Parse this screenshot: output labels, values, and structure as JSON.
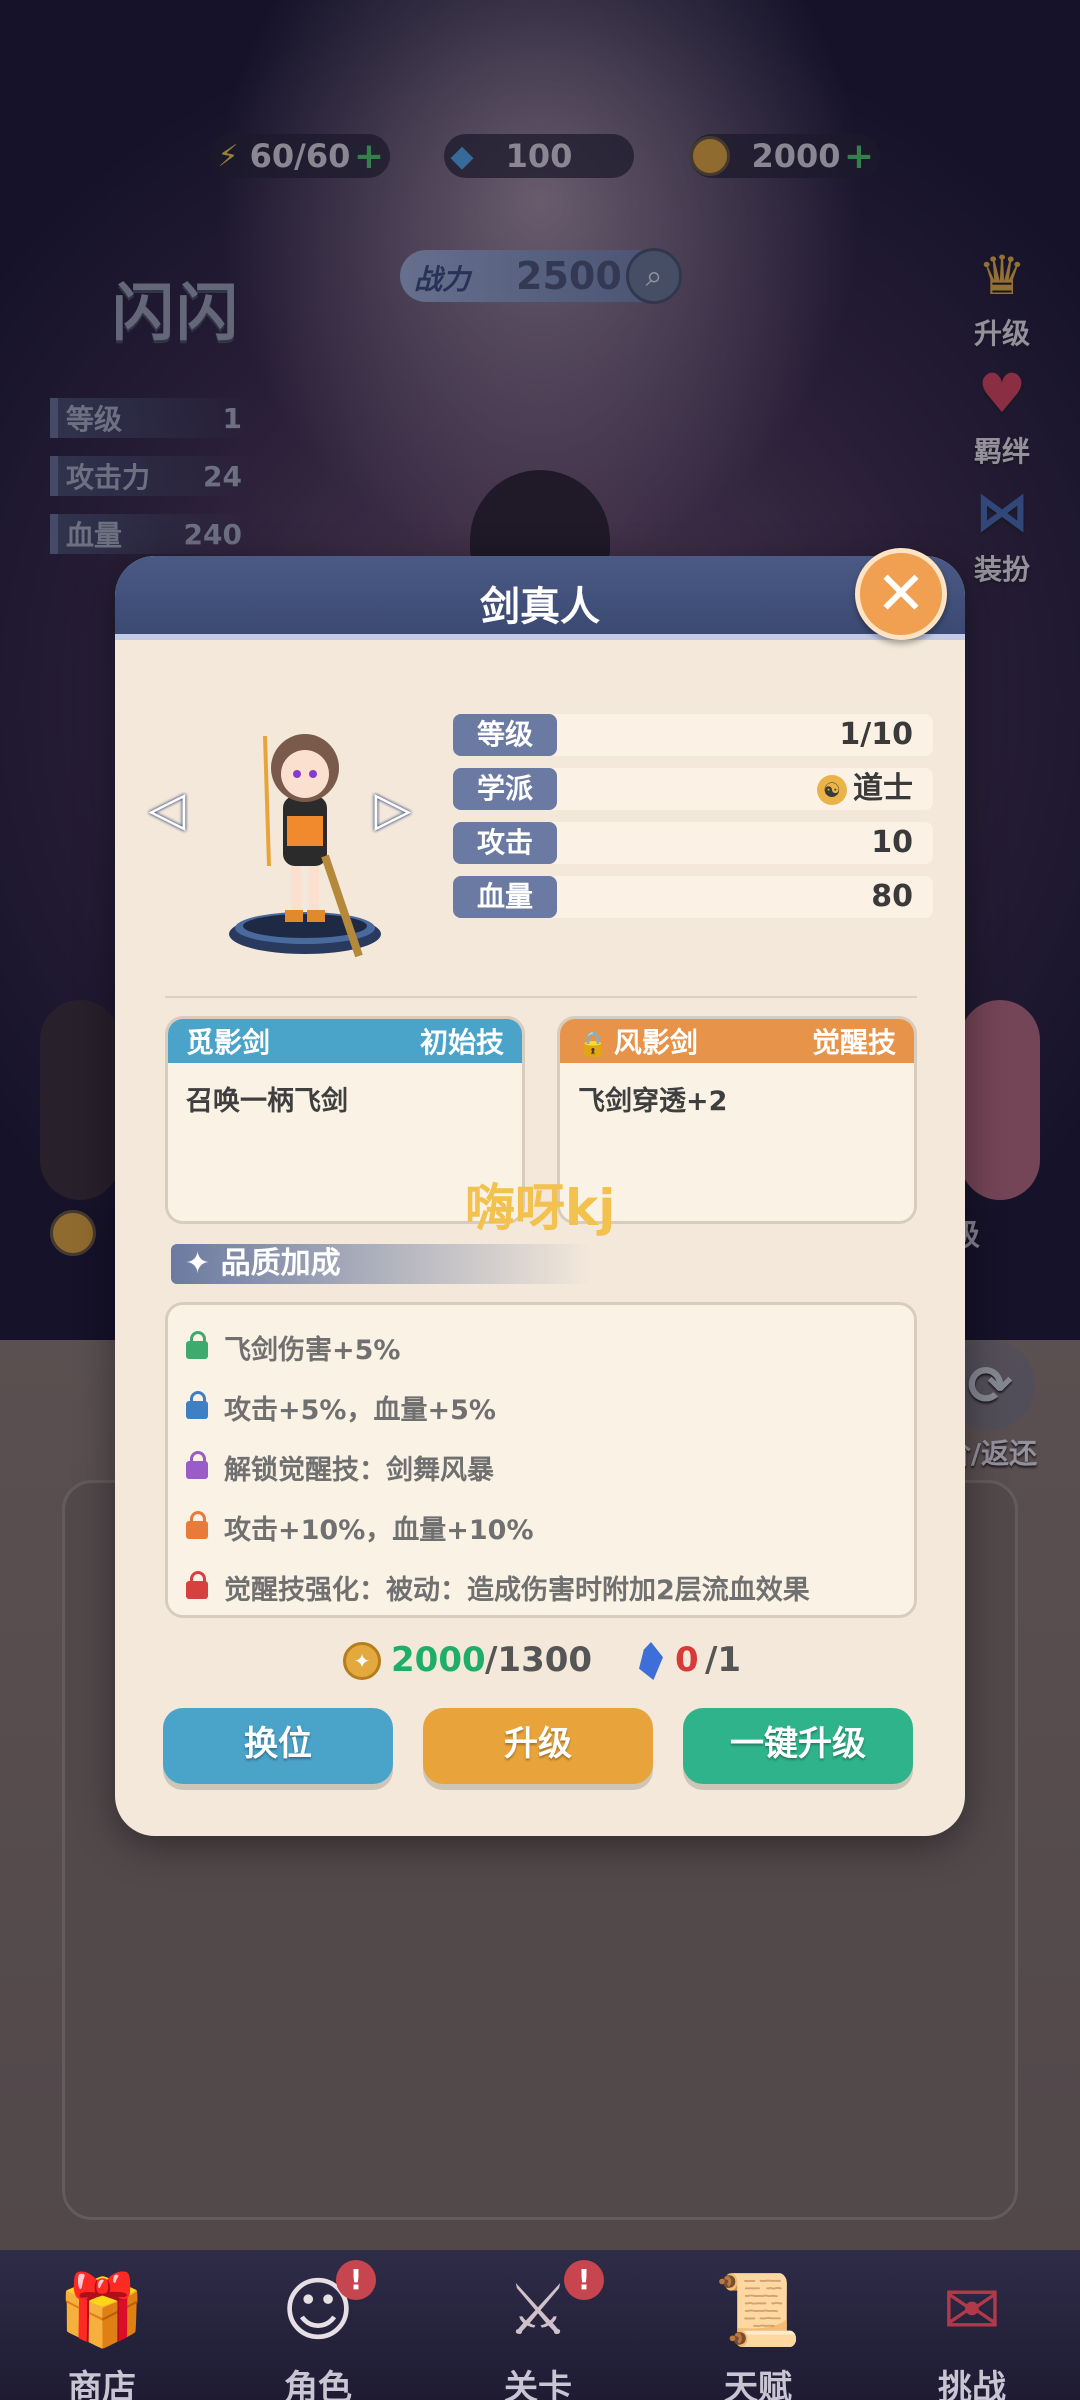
{
  "resources": {
    "energy": "60/60",
    "diamond": "100",
    "gold": "2000"
  },
  "character": {
    "name": "闪闪",
    "power_label": "战力",
    "power_value": "2500",
    "stats": [
      {
        "label": "等级",
        "value": "1"
      },
      {
        "label": "攻击力",
        "value": "24"
      },
      {
        "label": "血量",
        "value": "240"
      }
    ]
  },
  "side_buttons": {
    "upgrade": "升级",
    "bond": "羁绊",
    "dress": "装扮",
    "return_partial": "阶/返还"
  },
  "background_partial_label": "级",
  "modal": {
    "title": "剑真人",
    "info": [
      {
        "label": "等级",
        "value": "1/10"
      },
      {
        "label": "学派",
        "value": "道士"
      },
      {
        "label": "攻击",
        "value": "10"
      },
      {
        "label": "血量",
        "value": "80"
      }
    ],
    "skills": [
      {
        "name": "觅影剑",
        "tag": "初始技",
        "desc": "召唤一柄飞剑",
        "color": "#4aa3c8"
      },
      {
        "name": "风影剑",
        "tag": "觉醒技",
        "desc": "飞剑穿透+2",
        "color": "#e8934a"
      }
    ],
    "watermark": "嗨呀kj",
    "quality_title": "品质加成",
    "quality_items": [
      {
        "text": "飞剑伤害+5%",
        "color": "#3daa6e"
      },
      {
        "text": "攻击+5%，血量+5%",
        "color": "#3f7fc4"
      },
      {
        "text": "解锁觉醒技：剑舞风暴",
        "color": "#9a5cc8"
      },
      {
        "text": "攻击+10%，血量+10%",
        "color": "#e87a3a"
      },
      {
        "text": "觉醒技强化：被动：造成伤害时附加2层流血效果",
        "color": "#d84040"
      }
    ],
    "cost": {
      "gold_have": "2000",
      "gold_need": "/1300",
      "crystal_have": "0",
      "crystal_need": "/1"
    },
    "buttons": {
      "swap": "换位",
      "upgrade": "升级",
      "auto_upgrade": "一键升级"
    }
  },
  "nav": [
    {
      "label": "商店",
      "icon": "gift-box-icon"
    },
    {
      "label": "角色",
      "icon": "character-icon",
      "badge": "!"
    },
    {
      "label": "关卡",
      "icon": "rifle-icon",
      "badge": "!"
    },
    {
      "label": "天赋",
      "icon": "scroll-icon"
    },
    {
      "label": "挑战",
      "icon": "challenge-icon"
    }
  ],
  "colors": {
    "header": "#3b4a72",
    "gold_green": "#1fae6a",
    "crystal_red": "#d83a3a",
    "swap_btn": "#4aa3c8",
    "upgrade_btn": "#e8a43a",
    "auto_btn": "#2fb38a",
    "close_btn": "#f0a050"
  }
}
